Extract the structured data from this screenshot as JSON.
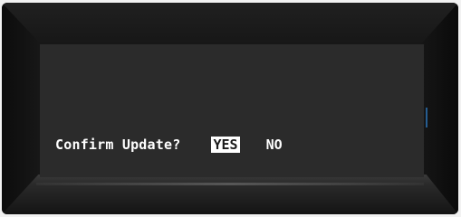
{
  "dialog": {
    "prompt": "Confirm Update?",
    "options": [
      {
        "label": "YES",
        "selected": true
      },
      {
        "label": "NO",
        "selected": false
      }
    ]
  },
  "colors": {
    "screen_bg": "#2b2b2b",
    "text": "#ffffff",
    "selected_bg": "#ffffff",
    "selected_text": "#1a1a1a",
    "bezel": "#141414"
  }
}
